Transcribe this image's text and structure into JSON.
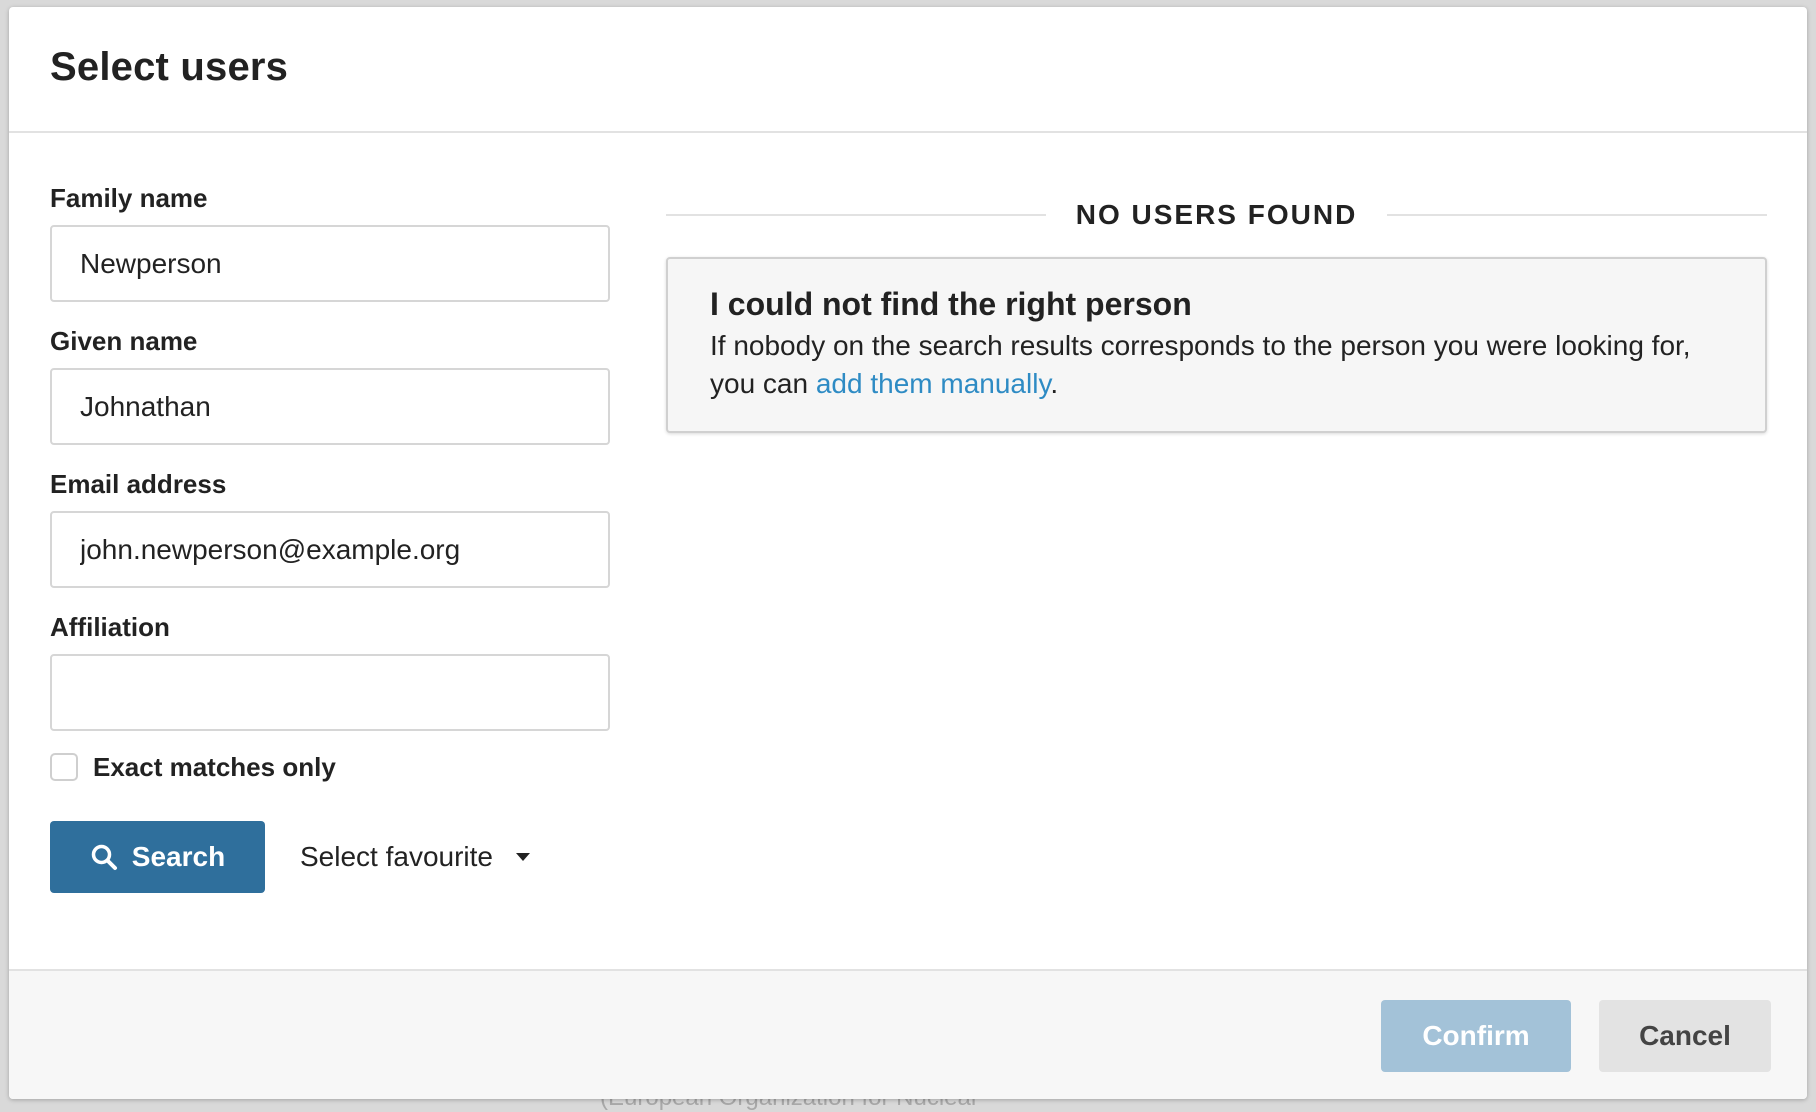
{
  "dialog": {
    "title": "Select users"
  },
  "form": {
    "family_name": {
      "label": "Family name",
      "value": "Newperson"
    },
    "given_name": {
      "label": "Given name",
      "value": "Johnathan"
    },
    "email": {
      "label": "Email address",
      "value": "john.newperson@example.org"
    },
    "affiliation": {
      "label": "Affiliation",
      "value": ""
    },
    "exact_matches": {
      "label": "Exact matches only",
      "checked": false
    },
    "search_label": "Search",
    "favourite_label": "Select favourite"
  },
  "results": {
    "heading": "NO USERS FOUND",
    "box_title": "I could not find the right person",
    "box_text_before": "If nobody on the search results corresponds to the person you were looking for, you can ",
    "box_link": "add them manually",
    "box_text_after": "."
  },
  "footer": {
    "confirm_label": "Confirm",
    "cancel_label": "Cancel"
  },
  "backdrop": {
    "text": "(European Organization for Nuclear"
  },
  "colors": {
    "primary": "#2f6f9c",
    "primary_disabled": "#a3c2d8",
    "link": "#2e8bc4"
  },
  "icons": {
    "search": "search-icon",
    "dropdown": "caret-down-icon"
  }
}
